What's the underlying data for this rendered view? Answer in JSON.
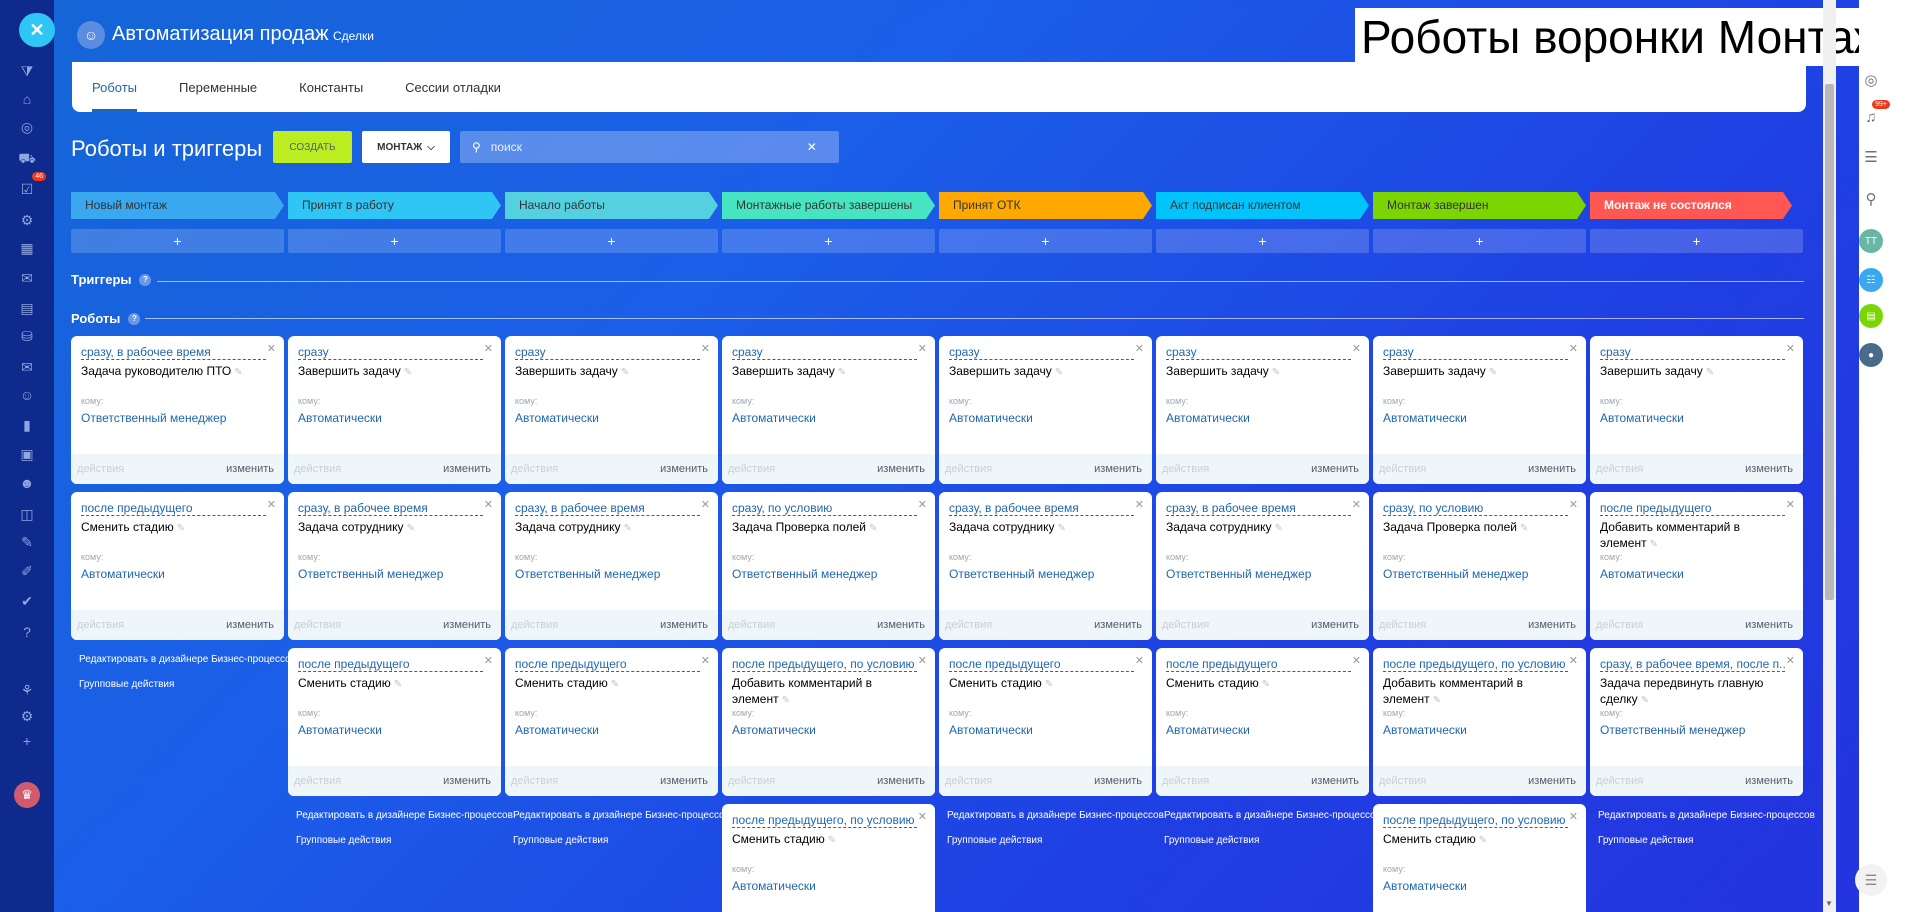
{
  "overlay_title": "Роботы воронки Монтаж",
  "app": {
    "title": "Автоматизация продаж",
    "subtitle": "Сделки"
  },
  "tabs": [
    {
      "label": "Роботы",
      "active": true
    },
    {
      "label": "Переменные"
    },
    {
      "label": "Константы"
    },
    {
      "label": "Сессии отладки"
    }
  ],
  "toolbar": {
    "title": "Роботы и триггеры",
    "create_label": "СОЗДАТЬ",
    "funnel_label": "МОНТАЖ",
    "search_placeholder": "поиск"
  },
  "stages": [
    {
      "name": "Новый монтаж",
      "color": "#39a8ef"
    },
    {
      "name": "Принят в работу",
      "color": "#2fc6f6"
    },
    {
      "name": "Начало работы",
      "color": "#55d0e0"
    },
    {
      "name": "Монтажные работы завершены",
      "color": "#47e4c2"
    },
    {
      "name": "Принят ОТК",
      "color": "#ffa900"
    },
    {
      "name": "Акт подписан клиентом",
      "color": "#00c4fb"
    },
    {
      "name": "Монтаж завершен",
      "color": "#7bd500"
    },
    {
      "name": "Монтаж не состоялся",
      "color": "#ff5752"
    }
  ],
  "add_label": "+",
  "sections": {
    "triggers": "Триггеры",
    "robots": "Роботы",
    "help": "?"
  },
  "labels": {
    "to": "кому:",
    "actions": "действия",
    "edit": "изменить",
    "designer": "Редактировать в дизайнере Бизнес-процессов",
    "group": "Групповые действия"
  },
  "columns": [
    {
      "robots": [
        {
          "cond": "сразу, в рабочее время",
          "title": "Задача руководителю ПТО",
          "resp": "Ответственный менеджер"
        },
        {
          "cond": "после предыдущего",
          "title": "Сменить стадию",
          "resp": "Автоматически"
        }
      ]
    },
    {
      "robots": [
        {
          "cond": "сразу",
          "title": "Завершить задачу",
          "resp": "Автоматически"
        },
        {
          "cond": "сразу, в рабочее время",
          "title": "Задача сотруднику",
          "resp": "Ответственный менеджер"
        },
        {
          "cond": "после предыдущего",
          "title": "Сменить стадию",
          "resp": "Автоматически"
        }
      ]
    },
    {
      "robots": [
        {
          "cond": "сразу",
          "title": "Завершить задачу",
          "resp": "Автоматически"
        },
        {
          "cond": "сразу, в рабочее время",
          "title": "Задача сотруднику",
          "resp": "Ответственный менеджер"
        },
        {
          "cond": "после предыдущего",
          "title": "Сменить стадию",
          "resp": "Автоматически"
        }
      ]
    },
    {
      "robots": [
        {
          "cond": "сразу",
          "title": "Завершить задачу",
          "resp": "Автоматически"
        },
        {
          "cond": "сразу, по условию",
          "title": "Задача Проверка полей",
          "resp": "Ответственный менеджер"
        },
        {
          "cond": "после предыдущего, по условию",
          "title": "Добавить комментарий в элемент",
          "resp": "Автоматически"
        },
        {
          "cond": "после предыдущего, по условию",
          "title": "Сменить стадию",
          "resp": "Автоматически"
        }
      ]
    },
    {
      "robots": [
        {
          "cond": "сразу",
          "title": "Завершить задачу",
          "resp": "Автоматически"
        },
        {
          "cond": "сразу, в рабочее время",
          "title": "Задача сотруднику",
          "resp": "Ответственный менеджер"
        },
        {
          "cond": "после предыдущего",
          "title": "Сменить стадию",
          "resp": "Автоматически"
        }
      ]
    },
    {
      "robots": [
        {
          "cond": "сразу",
          "title": "Завершить задачу",
          "resp": "Автоматически"
        },
        {
          "cond": "сразу, в рабочее время",
          "title": "Задача сотруднику",
          "resp": "Ответственный менеджер"
        },
        {
          "cond": "после предыдущего",
          "title": "Сменить стадию",
          "resp": "Автоматически"
        }
      ]
    },
    {
      "robots": [
        {
          "cond": "сразу",
          "title": "Завершить задачу",
          "resp": "Автоматически"
        },
        {
          "cond": "сразу, по условию",
          "title": "Задача Проверка полей",
          "resp": "Ответственный менеджер"
        },
        {
          "cond": "после предыдущего, по условию",
          "title": "Добавить комментарий в элемент",
          "resp": "Автоматически"
        },
        {
          "cond": "после предыдущего, по условию",
          "title": "Сменить стадию",
          "resp": "Автоматически"
        }
      ]
    },
    {
      "robots": [
        {
          "cond": "сразу",
          "title": "Завершить задачу",
          "resp": "Автоматически"
        },
        {
          "cond": "после предыдущего",
          "title": "Добавить комментарий в элемент",
          "resp": "Автоматически"
        },
        {
          "cond": "сразу, в рабочее время, после п...",
          "title": "Задача передвинуть главную сделку",
          "resp": "Ответственный менеджер"
        }
      ]
    }
  ],
  "left_sidebar": {
    "icons": [
      "filter-icon",
      "home-icon",
      "target-icon",
      "cart-icon",
      "tasks-icon",
      "settings-icon",
      "doc-icon",
      "chat-icon",
      "file-icon",
      "drive-icon",
      "mail-icon",
      "people-icon",
      "chart-icon",
      "contact-icon",
      "robot-icon",
      "box-icon",
      "sign-icon",
      "pen-icon",
      "check-icon",
      "help-icon",
      "structure-icon",
      "gear-icon",
      "plus-icon"
    ],
    "tasks_badge": "46"
  },
  "right_sidebar": {
    "notifications_badge": "99+",
    "avatar_initials": "TT"
  }
}
